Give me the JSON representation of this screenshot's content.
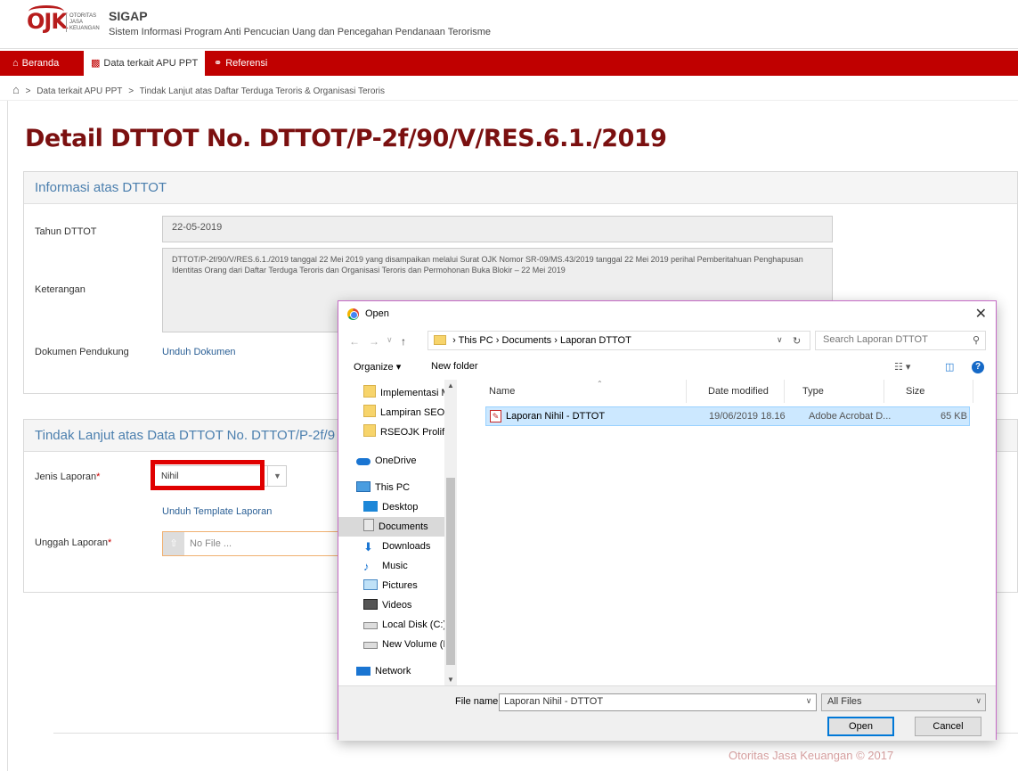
{
  "header": {
    "logo_text": "OJK",
    "logo_sub": [
      "OTORITAS",
      "JASA",
      "KEUANGAN"
    ],
    "app_title": "SIGAP",
    "app_subtitle": "Sistem Informasi Program Anti Pencucian Uang dan Pencegahan Pendanaan Terorisme"
  },
  "nav": {
    "items": [
      {
        "label": "Beranda",
        "icon": "home-icon"
      },
      {
        "label": "Data terkait APU PPT",
        "icon": "book-icon"
      },
      {
        "label": "Referensi",
        "icon": "link-icon"
      }
    ]
  },
  "breadcrumb": {
    "items": [
      "Data terkait APU PPT",
      "Tindak Lanjut atas Daftar Terduga Teroris & Organisasi Teroris"
    ]
  },
  "page": {
    "title": "Detail DTTOT No. DTTOT/P-2f/90/V/RES.6.1./2019"
  },
  "info_panel": {
    "heading": "Informasi atas DTTOT",
    "tahun_label": "Tahun DTTOT",
    "tahun_value": "22-05-2019",
    "keterangan_label": "Keterangan",
    "keterangan_value": "DTTOT/P-2f/90/V/RES.6.1./2019 tanggal 22 Mei 2019 yang disampaikan melalui Surat OJK Nomor SR-09/MS.43/2019 tanggal 22 Mei 2019 perihal Pemberitahuan Penghapusan Identitas Orang dari Daftar Terduga Teroris dan Organisasi Teroris dan Permohonan Buka Blokir – 22 Mei 2019",
    "dokumen_label": "Dokumen Pendukung",
    "dokumen_link": "Unduh Dokumen"
  },
  "followup_panel": {
    "heading": "Tindak Lanjut atas Data DTTOT No. DTTOT/P-2f/9",
    "jenis_label": "Jenis Laporan",
    "jenis_value": "Nihil",
    "template_link": "Unduh Template Laporan",
    "unggah_label": "Unggah Laporan",
    "file_placeholder": "No File ...",
    "required_mark": "*"
  },
  "footer": {
    "text": "Otoritas Jasa Keuangan © 2017"
  },
  "dialog": {
    "title": "Open",
    "path": [
      "This PC",
      "Documents",
      "Laporan DTTOT"
    ],
    "search_placeholder": "Search Laporan DTTOT",
    "organize_label": "Organize ▾",
    "new_folder_label": "New folder",
    "nav_tree": [
      {
        "label": "Implementasi M",
        "icon": "folder-icon"
      },
      {
        "label": "Lampiran SEOJK",
        "icon": "folder-icon"
      },
      {
        "label": "RSEOJK Prolifera",
        "icon": "folder-icon"
      },
      {
        "label": "OneDrive",
        "icon": "onedrive-icon"
      },
      {
        "label": "This PC",
        "icon": "pc-icon"
      },
      {
        "label": "Desktop",
        "icon": "desktop-icon"
      },
      {
        "label": "Documents",
        "icon": "documents-icon"
      },
      {
        "label": "Downloads",
        "icon": "downloads-icon"
      },
      {
        "label": "Music",
        "icon": "music-icon"
      },
      {
        "label": "Pictures",
        "icon": "pictures-icon"
      },
      {
        "label": "Videos",
        "icon": "videos-icon"
      },
      {
        "label": "Local Disk (C:)",
        "icon": "disk-icon"
      },
      {
        "label": "New Volume (D:",
        "icon": "volume-icon"
      },
      {
        "label": "Network",
        "icon": "network-icon"
      }
    ],
    "columns": [
      "Name",
      "Date modified",
      "Type",
      "Size"
    ],
    "files": [
      {
        "name": "Laporan Nihil - DTTOT",
        "date": "19/06/2019 18.16",
        "type": "Adobe Acrobat D...",
        "size": "65 KB"
      }
    ],
    "filename_label": "File name:",
    "filename_value": "Laporan Nihil - DTTOT",
    "filter_value": "All Files",
    "open_label": "Open",
    "cancel_label": "Cancel"
  }
}
